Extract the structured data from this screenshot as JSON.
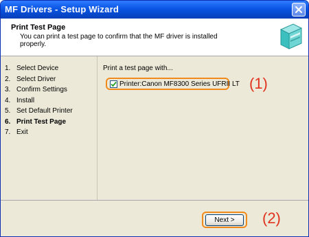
{
  "window": {
    "title": "MF Drivers - Setup Wizard",
    "close_icon": "close-icon"
  },
  "header": {
    "title": "Print Test Page",
    "description": "You can print a test page to confirm that the MF driver is installed properly.",
    "icon": "printer-icon"
  },
  "steps": [
    {
      "num": "1.",
      "label": "Select Device",
      "active": false
    },
    {
      "num": "2.",
      "label": "Select Driver",
      "active": false
    },
    {
      "num": "3.",
      "label": "Confirm Settings",
      "active": false
    },
    {
      "num": "4.",
      "label": "Install",
      "active": false
    },
    {
      "num": "5.",
      "label": "Set Default Printer",
      "active": false
    },
    {
      "num": "6.",
      "label": "Print Test Page",
      "active": true
    },
    {
      "num": "7.",
      "label": "Exit",
      "active": false
    }
  ],
  "main": {
    "prompt": "Print a test page with...",
    "printer_option": {
      "label": "Printer:Canon MF8300 Series UFRII LT",
      "checked": true
    }
  },
  "footer": {
    "next_label": "Next >"
  },
  "callouts": {
    "one": "(1)",
    "two": "(2)"
  },
  "colors": {
    "highlight": "#f08a1c",
    "callout": "#e0321e",
    "titlebar": "#0a55e3"
  }
}
